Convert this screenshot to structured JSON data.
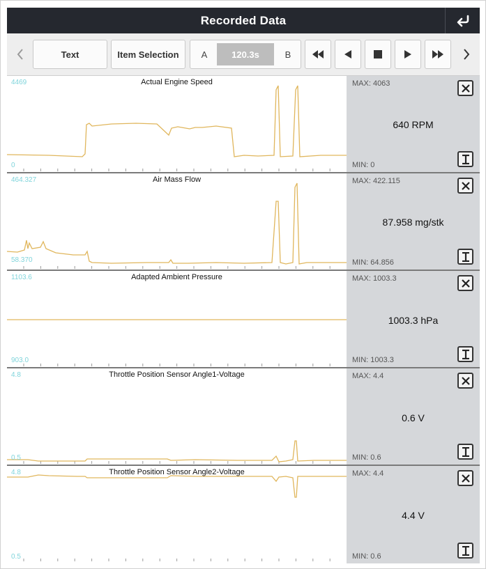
{
  "header": {
    "title": "Recorded Data"
  },
  "toolbar": {
    "text_label": "Text",
    "item_selection_label": "Item Selection",
    "cursor_a_label": "A",
    "time_value": "120.3s",
    "cursor_b_label": "B"
  },
  "colors": {
    "trace": "#e0b65c",
    "axis_label": "#7fd4db",
    "sidebar_bg": "#d5d7da",
    "titlebar_bg": "#25282f"
  },
  "panels": [
    {
      "title": "Actual Engine Speed",
      "ymax": "4469",
      "ymin": "0",
      "max": "MAX: 4063",
      "min": "MIN: 0",
      "current": "640 RPM"
    },
    {
      "title": "Air Mass Flow",
      "ymax": "464.327",
      "ymin": "58.370",
      "max": "MAX: 422.115",
      "min": "MIN: 64.856",
      "current": "87.958 mg/stk"
    },
    {
      "title": "Adapted Ambient Pressure",
      "ymax": "1103.6",
      "ymin": "903.0",
      "max": "MAX: 1003.3",
      "min": "MIN: 1003.3",
      "current": "1003.3 hPa"
    },
    {
      "title": "Throttle Position Sensor Angle1-Voltage",
      "ymax": "4.8",
      "ymin": "0.5",
      "max": "MAX: 4.4",
      "min": "MIN: 0.6",
      "current": "0.6 V"
    },
    {
      "title": "Throttle Position Sensor Angle2-Voltage",
      "ymax": "4.8",
      "ymin": "0.5",
      "max": "MAX: 4.4",
      "min": "MIN: 0.6",
      "current": "4.4 V"
    }
  ]
}
